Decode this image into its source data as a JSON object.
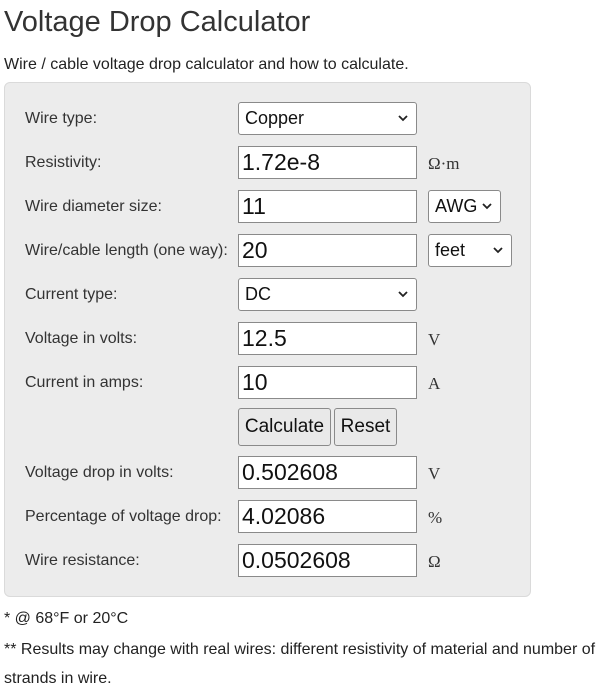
{
  "page": {
    "title": "Voltage Drop Calculator",
    "subtitle": "Wire / cable voltage drop calculator and how to calculate."
  },
  "form": {
    "wire_type": {
      "label": "Wire type:",
      "selected": "Copper"
    },
    "resistivity": {
      "label": "Resistivity:",
      "value": "1.72e-8",
      "unit": "Ω·m"
    },
    "wire_diameter": {
      "label": "Wire diameter size:",
      "value": "11",
      "unit_selected": "AWG"
    },
    "wire_length": {
      "label": "Wire/cable length (one way):",
      "value": "20",
      "unit_selected": "feet"
    },
    "current_type": {
      "label": "Current type:",
      "selected": "DC"
    },
    "voltage": {
      "label": "Voltage in volts:",
      "value": "12.5",
      "unit": "V"
    },
    "current": {
      "label": "Current in amps:",
      "value": "10",
      "unit": "A"
    },
    "calculate_label": "Calculate",
    "reset_label": "Reset"
  },
  "results": {
    "voltage_drop": {
      "label": "Voltage drop in volts:",
      "value": "0.502608",
      "unit": "V"
    },
    "percentage_drop": {
      "label": "Percentage of voltage drop:",
      "value": "4.02086",
      "unit": "%"
    },
    "wire_resistance": {
      "label": "Wire resistance:",
      "value": "0.0502608",
      "unit": "Ω"
    }
  },
  "notes": {
    "note1": "* @ 68°F or 20°C",
    "note2_line1": "** Results may change with real wires: different resistivity of material and number of",
    "note2_line2": "strands in wire."
  },
  "icons": {
    "dropdown": "chevron-down-icon"
  },
  "colors": {
    "panel_background": "#ececec",
    "panel_border": "#dadada",
    "button_background": "#e9e9e9",
    "field_border": "#8a8a8a"
  }
}
